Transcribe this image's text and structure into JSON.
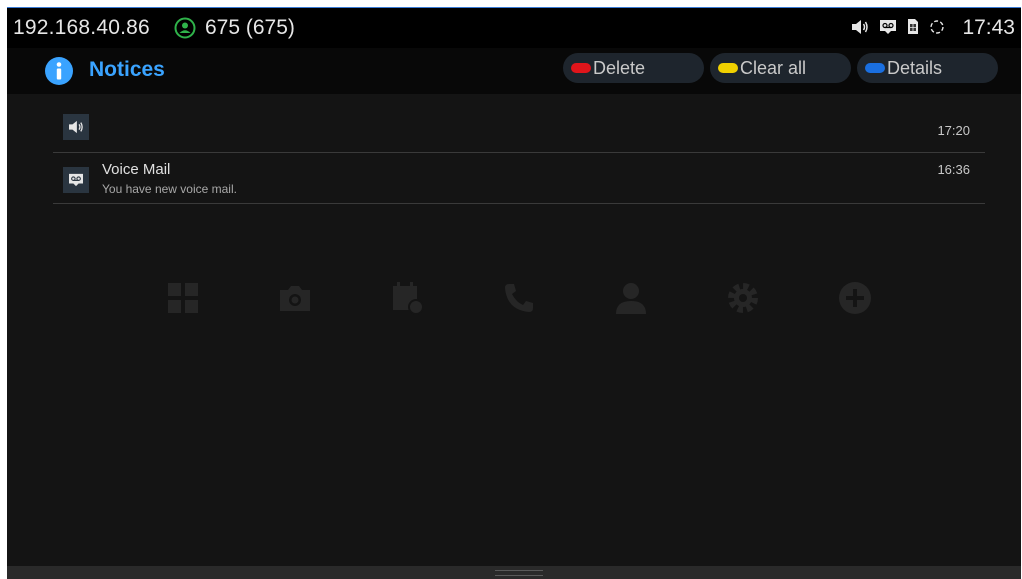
{
  "status_bar": {
    "ip": "192.168.40.86",
    "account": "675 (675)",
    "time": "17:43",
    "icons": [
      "speaker-icon",
      "voicemail-icon",
      "sim-icon",
      "sync-icon"
    ]
  },
  "header": {
    "title": "Notices",
    "softkeys": [
      {
        "label": "Delete",
        "color": "#e0151b"
      },
      {
        "label": "Clear all",
        "color": "#f0d000"
      },
      {
        "label": "Details",
        "color": "#1a6fe0"
      }
    ]
  },
  "notices": [
    {
      "icon": "speaker-icon",
      "title": "",
      "subtitle": "",
      "time": "17:20"
    },
    {
      "icon": "voicemail-icon",
      "title": "Voice Mail",
      "subtitle": "You have new voice mail.",
      "time": "16:36"
    }
  ],
  "launcher_icons": [
    "apps-icon",
    "camera-icon",
    "calendar-icon",
    "phone-icon",
    "contacts-icon",
    "settings-icon",
    "add-icon"
  ],
  "colors": {
    "accent": "#3aa3ff",
    "background": "#141414",
    "status_bar": "#000000",
    "account_icon": "#2fb34a"
  }
}
